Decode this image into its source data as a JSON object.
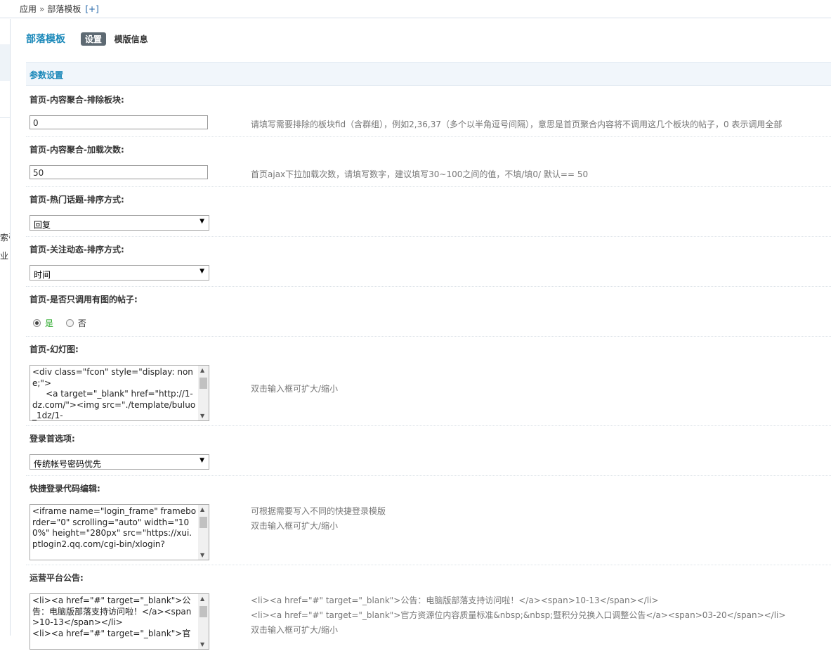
{
  "breadcrumb": {
    "root": "应用",
    "separator": "»",
    "current": "部落模板",
    "add_label": "[+]"
  },
  "sidebar": {
    "cut_text_1": "索引",
    "cut_text_2": "业"
  },
  "header": {
    "title": "部落模板",
    "tabs": [
      {
        "label": "设置",
        "active": true
      },
      {
        "label": "模版信息",
        "active": false
      }
    ]
  },
  "section": {
    "title": "参数设置"
  },
  "settings": {
    "exclude_boards": {
      "label": "首页-内容聚合-排除板块:",
      "value": "0",
      "hint": "请填写需要排除的板块fid（含群组），例如2,36,37（多个以半角逗号间隔），意思是首页聚合内容将不调用这几个板块的帖子，0 表示调用全部"
    },
    "load_times": {
      "label": "首页-内容聚合-加载次数:",
      "value": "50",
      "hint": "首页ajax下拉加载次数，请填写数字，建议填写30~100之间的值，不填/填0/ 默认== 50"
    },
    "hot_topic_sort": {
      "label": "首页-热门话题-排序方式:",
      "selected": "回复"
    },
    "follow_sort": {
      "label": "首页-关注动态-排序方式:",
      "selected": "时间"
    },
    "image_only": {
      "label": "首页-是否只调用有图的帖子:",
      "yes": "是",
      "no": "否",
      "selected": "yes"
    },
    "slideshow": {
      "label": "首页-幻灯图:",
      "value": "<div class=\"fcon\" style=\"display: none;\">\n     <a target=\"_blank\" href=\"http://1-dz.com/\"><img src=\"./template/buluo_1dz/1-",
      "hint": "双击输入框可扩大/缩小"
    },
    "login_pref": {
      "label": "登录首选项:",
      "selected": "传统帐号密码优先"
    },
    "quick_login": {
      "label": "快捷登录代码编辑:",
      "value": "<iframe name=\"login_frame\" frameborder=\"0\" scrolling=\"auto\" width=\"100%\" height=\"280px\" src=\"https://xui.ptlogin2.qq.com/cgi-bin/xlogin?",
      "hints": [
        "可根据需要写入不同的快捷登录模版",
        "双击输入框可扩大/缩小"
      ]
    },
    "notices": {
      "label": "运营平台公告:",
      "value": "<li><a href=\"#\" target=\"_blank\">公告：电脑版部落支持访问啦！</a><span>10-13</span></li>\n<li><a href=\"#\" target=\"_blank\">官",
      "hints": [
        "<li><a href=\"#\" target=\"_blank\">公告：电脑版部落支持访问啦！</a><span>10-13</span></li>",
        "<li><a href=\"#\" target=\"_blank\">官方资源位内容质量标准&nbsp;&nbsp;暨积分兑换入口调整公告</a><span>03-20</span></li>",
        "双击输入框可扩大/缩小"
      ]
    }
  }
}
